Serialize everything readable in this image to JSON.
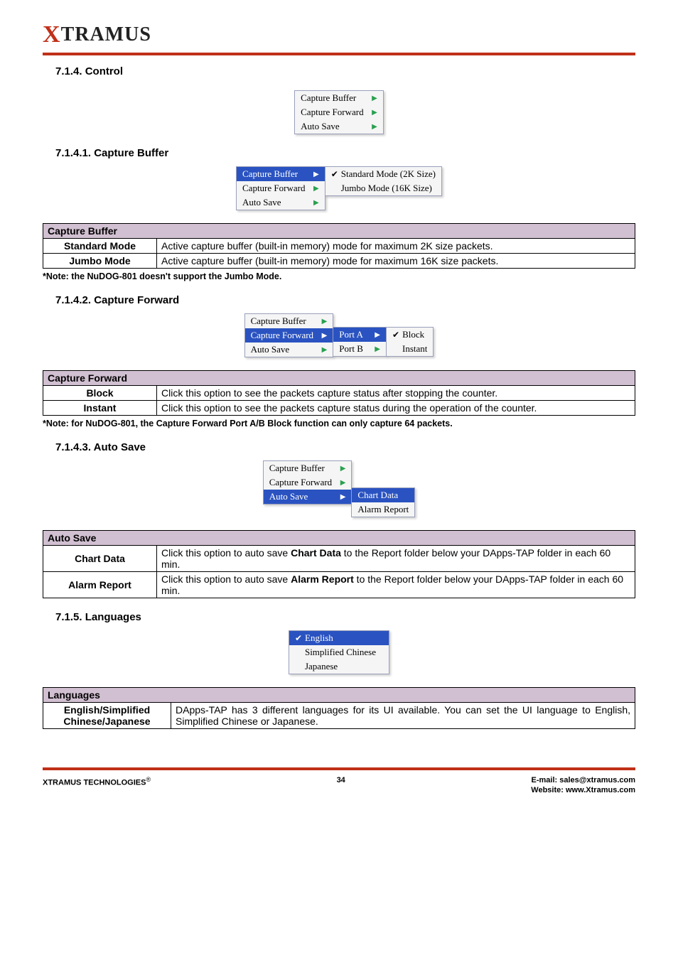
{
  "brand": {
    "x": "X",
    "rest": "TRAMUS"
  },
  "section": {
    "control": "7.1.4. Control",
    "capture_buffer_h": "7.1.4.1. Capture Buffer",
    "capture_forward_h": "7.1.4.2. Capture Forward",
    "auto_save_h": "7.1.4.3. Auto Save",
    "languages_h": "7.1.5. Languages"
  },
  "menu": {
    "capture_buffer": "Capture Buffer",
    "capture_forward": "Capture Forward",
    "auto_save": "Auto Save",
    "std_mode": "Standard Mode (2K Size)",
    "jumbo_mode": "Jumbo Mode (16K Size)",
    "port_a": "Port A",
    "port_b": "Port B",
    "block": "Block",
    "instant": "Instant",
    "chart_data": "Chart Data",
    "alarm_report": "Alarm Report",
    "english": "English",
    "simplified_chinese": "Simplified Chinese",
    "japanese": "Japanese"
  },
  "tbl_capture_buffer": {
    "header": "Capture Buffer",
    "rows": [
      {
        "label": "Standard Mode",
        "desc": "Active capture buffer (built-in memory) mode for maximum 2K size packets."
      },
      {
        "label": "Jumbo Mode",
        "desc": "Active capture buffer (built-in memory) mode for maximum 16K size packets."
      }
    ],
    "note": "*Note: the NuDOG-801 doesn't support the Jumbo Mode."
  },
  "tbl_capture_forward": {
    "header": "Capture Forward",
    "rows": [
      {
        "label": "Block",
        "desc": "Click this option to see the packets capture status after stopping the counter."
      },
      {
        "label": "Instant",
        "desc": "Click this option to see the packets capture status during the operation of the counter."
      }
    ],
    "note": "*Note: for NuDOG-801, the Capture Forward Port A/B Block function can only capture 64 packets."
  },
  "tbl_auto_save": {
    "header": "Auto Save",
    "rows": [
      {
        "label": "Chart Data",
        "pre": "Click this option to auto save ",
        "bold": "Chart Data",
        "post": " to the Report folder below your DApps-TAP folder in each 60 min."
      },
      {
        "label": "Alarm Report",
        "pre": "Click this option to auto save ",
        "bold": "Alarm Report",
        "post": " to the Report folder below your DApps-TAP folder in each 60 min."
      }
    ]
  },
  "tbl_languages": {
    "header": "Languages",
    "row_label_l1": "English/Simplified",
    "row_label_l2": "Chinese/Japanese",
    "desc": "DApps-TAP has 3 different languages for its UI available. You can set the UI language to English, Simplified Chinese or Japanese."
  },
  "footer": {
    "left": "XTRAMUS TECHNOLOGIES",
    "page": "34",
    "email_label": "E-mail: ",
    "email": "sales@xtramus.com",
    "site_label": "Website:  ",
    "site": "www.Xtramus.com"
  }
}
